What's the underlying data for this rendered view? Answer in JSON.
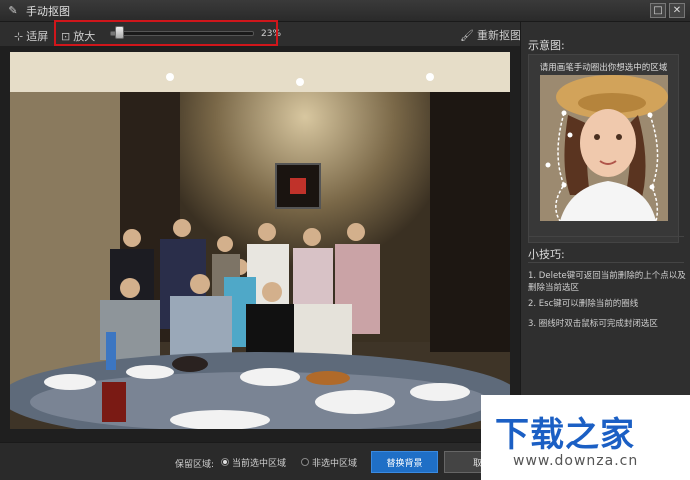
{
  "window": {
    "title": "手动抠图",
    "min_glyph": "□",
    "close_glyph": "✕"
  },
  "toolbar": {
    "fit_label": "适屏",
    "zoom_label": "放大",
    "zoom_percent": "23%",
    "zoom_value": 0.06,
    "redraw_label": "重新抠图"
  },
  "side": {
    "example_heading": "示意图:",
    "example_caption": "请用画笔手动圈出你想选中的区域",
    "tips_heading": "小技巧:",
    "tips": [
      "1. Delete键可返回当前删除的上个点以及删除当前选区",
      "2. Esc键可以删除当前的圈线",
      "3. 圈线时双击鼠标可完成封闭选区"
    ]
  },
  "bottom": {
    "keep_label": "保留区域:",
    "option_current": "当前选中区域",
    "option_noncurrent": "非选中区域",
    "replace_button": "替换背景",
    "cancel_button": "取"
  },
  "watermark": {
    "title": "下载之家",
    "url": "www.downza.cn"
  },
  "colors": {
    "accent": "#1f6fc6",
    "highlight": "#d0161b",
    "watermark_blue": "#1b5fc4"
  }
}
